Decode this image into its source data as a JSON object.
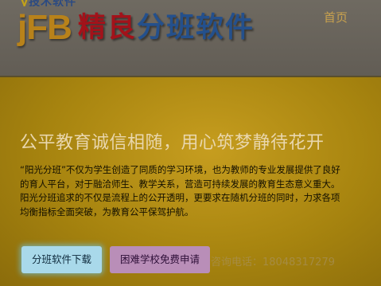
{
  "header": {
    "logo_top": {
      "brand_prefix": "y",
      "text": "技术软件"
    },
    "logo_latin": "jFB",
    "logo_cn_1": "精良",
    "logo_cn_2": "分班软件",
    "nav_home": "首页"
  },
  "hero": {
    "title": "公平教育诚信相随，用心筑梦静待花开",
    "lines": [
      "“阳光分班”不仅为学生创造了同质的学习环境，也为教师的专业发展提供了良好",
      "的育人平台，对于融洽师生、教学关系，营造可持续发展的教育生态意义重大。",
      "阳光分班追求的不仅是流程上的公开透明，更要求在随机分班的同时，力求各项",
      "均衡指标全面突破，为教育公平保驾护航。"
    ],
    "download_button": "分班软件下载",
    "apply_button": "困难学校免费申请",
    "phone_watermark": "咨询电话：18048317279"
  },
  "colors": {
    "header_bg": "#655f57",
    "hero_gold": "#b08c15",
    "logo_red": "#a3121a",
    "logo_blue": "#24508c",
    "download_button_bg": "#a9d9ea",
    "apply_button_bg": "#b98eb8"
  }
}
